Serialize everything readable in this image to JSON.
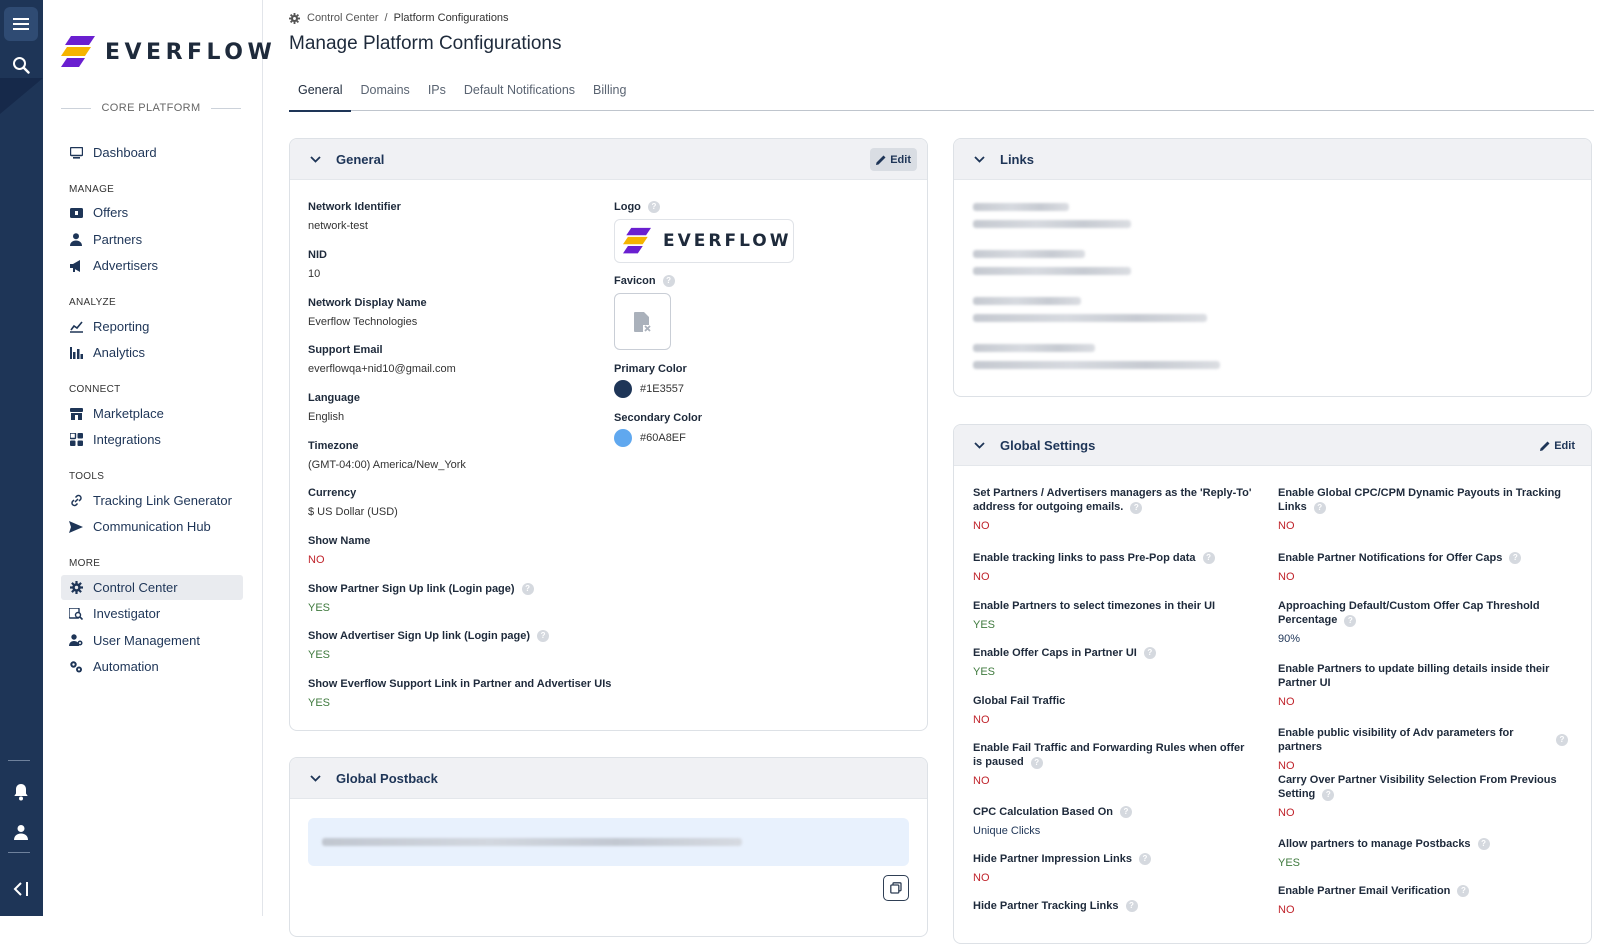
{
  "app": {
    "brand": "EVERFLOW",
    "platform_label": "CORE PLATFORM"
  },
  "sidebar": {
    "dashboard": "Dashboard",
    "sections": {
      "manage": "MANAGE",
      "analyze": "ANALYZE",
      "connect": "CONNECT",
      "tools": "TOOLS",
      "more": "MORE"
    },
    "items": {
      "offers": "Offers",
      "partners": "Partners",
      "advertisers": "Advertisers",
      "reporting": "Reporting",
      "analytics": "Analytics",
      "marketplace": "Marketplace",
      "integrations": "Integrations",
      "tracking_link_generator": "Tracking Link Generator",
      "communication_hub": "Communication Hub",
      "control_center": "Control Center",
      "investigator": "Investigator",
      "user_management": "User Management",
      "automation": "Automation"
    },
    "active": "control_center"
  },
  "breadcrumb": {
    "root": "Control Center",
    "separator": "/",
    "current": "Platform Configurations"
  },
  "page": {
    "title": "Manage Platform Configurations"
  },
  "tabs": [
    "General",
    "Domains",
    "IPs",
    "Default Notifications",
    "Billing"
  ],
  "active_tab": "General",
  "general": {
    "title": "General",
    "edit_label": "Edit",
    "fields": [
      {
        "label": "Network Identifier",
        "value": "network-test"
      },
      {
        "label": "NID",
        "value": "10"
      },
      {
        "label": "Network Display Name",
        "value": "Everflow Technologies"
      },
      {
        "label": "Support Email",
        "value": "everflowqa+nid10@gmail.com"
      },
      {
        "label": "Language",
        "value": "English"
      },
      {
        "label": "Timezone",
        "value": "(GMT-04:00) America/New_York"
      },
      {
        "label": "Currency",
        "value": "$ US Dollar (USD)"
      },
      {
        "label": "Show Name",
        "value": "NO"
      },
      {
        "label": "Show Partner Sign Up link (Login page)",
        "value": "YES"
      },
      {
        "label": "Show Advertiser Sign Up link (Login page)",
        "value": "YES"
      },
      {
        "label": "Show Everflow Support Link in Partner and Advertiser UIs",
        "value": "YES"
      }
    ],
    "logo_label": "Logo",
    "logo_text": "EVERFLOW",
    "favicon_label": "Favicon",
    "primary_color_label": "Primary Color",
    "primary_color": "#1E3557",
    "secondary_color_label": "Secondary Color",
    "secondary_color": "#60A8EF"
  },
  "links": {
    "title": "Links"
  },
  "global_postback": {
    "title": "Global Postback"
  },
  "global_settings": {
    "title": "Global Settings",
    "edit_label": "Edit",
    "left": [
      {
        "label": "Set Partners / Advertisers managers as the 'Reply-To' address for outgoing emails.",
        "value": "NO"
      },
      {
        "label": "Enable tracking links to pass Pre-Pop data",
        "value": "NO"
      },
      {
        "label": "Enable Partners to select timezones in their UI",
        "value": "YES"
      },
      {
        "label": "Enable Offer Caps in Partner UI",
        "value": "YES"
      },
      {
        "label": "Global Fail Traffic",
        "value": "NO"
      },
      {
        "label": "Enable Fail Traffic and Forwarding Rules when offer is paused",
        "value": "NO"
      },
      {
        "label": "CPC Calculation Based On",
        "value": "Unique Clicks"
      },
      {
        "label": "Hide Partner Impression Links",
        "value": "NO"
      },
      {
        "label": "Hide Partner Tracking Links",
        "value": ""
      }
    ],
    "right": [
      {
        "label": "Enable Global CPC/CPM Dynamic Payouts in Tracking Links",
        "value": "NO"
      },
      {
        "label": "Enable Partner Notifications for Offer Caps",
        "value": "NO"
      },
      {
        "label": "Approaching Default/Custom Offer Cap Threshold Percentage",
        "value": "90%"
      },
      {
        "label": "Enable Partners to update billing details inside their Partner UI",
        "value": "NO"
      },
      {
        "label": "Enable public visibility of Adv parameters for partners",
        "value": "NO"
      },
      {
        "label": "Carry Over Partner Visibility Selection From Previous Setting",
        "value": "NO"
      },
      {
        "label": "Allow partners to manage Postbacks",
        "value": "YES"
      },
      {
        "label": "Enable Partner Email Verification",
        "value": "NO"
      }
    ]
  }
}
